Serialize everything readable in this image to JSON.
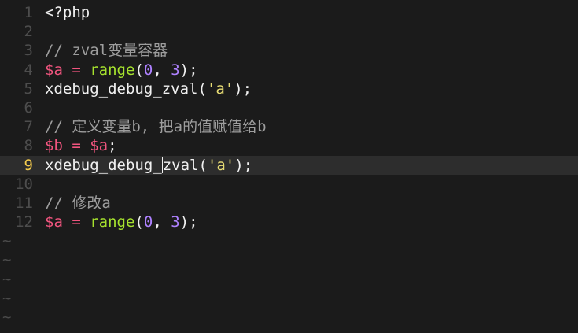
{
  "editor": {
    "lines": [
      {
        "num": "1",
        "parts": [
          {
            "t": "<?php",
            "c": "kw"
          }
        ]
      },
      {
        "num": "2",
        "parts": []
      },
      {
        "num": "3",
        "parts": [
          {
            "t": "// zval变量容器",
            "c": "cm"
          }
        ]
      },
      {
        "num": "4",
        "parts": [
          {
            "t": "$a",
            "c": "var"
          },
          {
            "t": " = ",
            "c": "op"
          },
          {
            "t": "range",
            "c": "fn"
          },
          {
            "t": "(",
            "c": "plain"
          },
          {
            "t": "0",
            "c": "num"
          },
          {
            "t": ", ",
            "c": "plain"
          },
          {
            "t": "3",
            "c": "num"
          },
          {
            "t": ");",
            "c": "plain"
          }
        ]
      },
      {
        "num": "5",
        "parts": [
          {
            "t": "xdebug_debug_zval(",
            "c": "plain"
          },
          {
            "t": "'a'",
            "c": "str"
          },
          {
            "t": ");",
            "c": "plain"
          }
        ]
      },
      {
        "num": "6",
        "parts": []
      },
      {
        "num": "7",
        "parts": [
          {
            "t": "// 定义变量b, 把a的值赋值给b",
            "c": "cm"
          }
        ]
      },
      {
        "num": "8",
        "parts": [
          {
            "t": "$b",
            "c": "var"
          },
          {
            "t": " = ",
            "c": "op"
          },
          {
            "t": "$a",
            "c": "var"
          },
          {
            "t": ";",
            "c": "plain"
          }
        ]
      },
      {
        "num": "9",
        "current": true,
        "parts": [
          {
            "t": "xdebug_debug_",
            "c": "plain"
          },
          {
            "cursor": true
          },
          {
            "t": "zval(",
            "c": "plain"
          },
          {
            "t": "'a'",
            "c": "str"
          },
          {
            "t": ");",
            "c": "plain"
          }
        ]
      },
      {
        "num": "10",
        "parts": []
      },
      {
        "num": "11",
        "parts": [
          {
            "t": "// 修改a",
            "c": "cm"
          }
        ]
      },
      {
        "num": "12",
        "parts": [
          {
            "t": "$a",
            "c": "var"
          },
          {
            "t": " = ",
            "c": "op"
          },
          {
            "t": "range",
            "c": "fn"
          },
          {
            "t": "(",
            "c": "plain"
          },
          {
            "t": "0",
            "c": "num"
          },
          {
            "t": ", ",
            "c": "plain"
          },
          {
            "t": "3",
            "c": "num"
          },
          {
            "t": ");",
            "c": "plain"
          }
        ]
      }
    ],
    "empty_line_marker": "~",
    "empty_line_count": 6
  },
  "colors": {
    "background": "#1b1b1b",
    "current_line": "#2d2d2d",
    "line_number": "#4d4d4d",
    "current_line_number": "#f2c94c",
    "variable": "#f2557f",
    "function": "#a6e22e",
    "number": "#ae81ff",
    "string": "#e6db74",
    "comment": "#9e9e9e"
  }
}
